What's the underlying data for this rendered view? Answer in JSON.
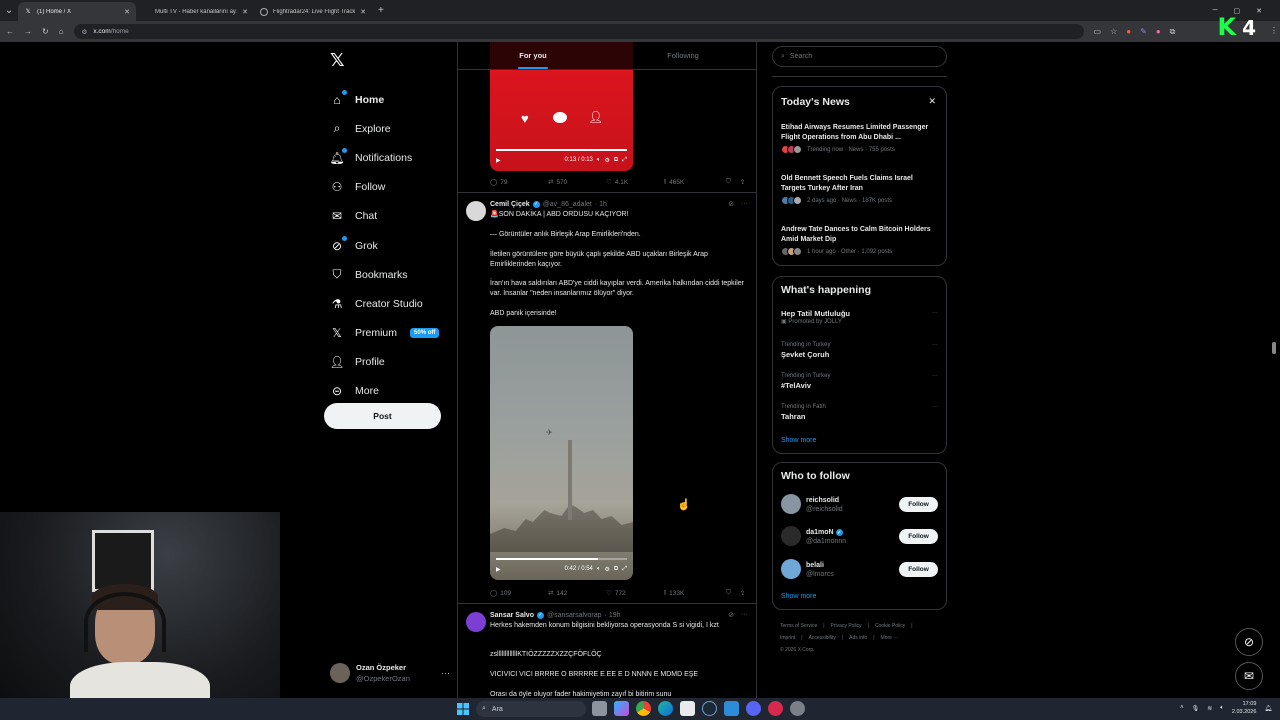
{
  "browser": {
    "tabs": [
      {
        "title": "(1) Home / X",
        "icon": "x-logo-icon",
        "active": true
      },
      {
        "title": "Multi TV - Haber kanallarını ay…",
        "icon": "tv-icon",
        "active": false
      },
      {
        "title": "Flightradar24: Live Flight Track…",
        "icon": "plane-icon",
        "active": false
      }
    ],
    "url_host": "x.com",
    "url_path": "/home",
    "kick_badge_letter": "K",
    "kick_badge_number": "4"
  },
  "nav": {
    "logo": "𝕏",
    "items": [
      {
        "label": "Home",
        "icon": "home-icon"
      },
      {
        "label": "Explore",
        "icon": "search-icon"
      },
      {
        "label": "Notifications",
        "icon": "bell-icon"
      },
      {
        "label": "Follow",
        "icon": "person-plus-icon"
      },
      {
        "label": "Chat",
        "icon": "mail-icon"
      },
      {
        "label": "Grok",
        "icon": "grok-icon"
      },
      {
        "label": "Bookmarks",
        "icon": "bookmark-icon"
      },
      {
        "label": "Creator Studio",
        "icon": "flask-icon"
      },
      {
        "label": "Premium",
        "icon": "x-logo-icon"
      },
      {
        "label": "Profile",
        "icon": "person-icon"
      },
      {
        "label": "More",
        "icon": "more-circle-icon"
      }
    ],
    "premium_badge": "50% off",
    "post_button": "Post",
    "account": {
      "name": "Ozan Özpeker",
      "handle": "@OzpekerOzan"
    }
  },
  "feed": {
    "tabs": [
      "For you",
      "Following"
    ],
    "first_post": {
      "video_time": "0:13 / 0:13",
      "replies": "79",
      "reposts": "570",
      "likes": "4.1K",
      "views": "465K"
    },
    "second_post": {
      "name": "Cemil Çiçek",
      "handle": "@av_86_adalet",
      "time": "· 1h",
      "lines": [
        "🚨SON DAKİKA | ABD ORDUSU KAÇIYOR!",
        "— Görüntüler anlık Birleşik Arap Emirlikleri'nden.",
        "İletilen görüntülere göre büyük çaplı şekilde ABD uçakları Birleşik Arap Emirliklerinden kaçıyor.",
        "İran'ın hava saldırıları ABD'ye ciddi kayıplar verdi. Amerika halkından ciddi tepkiler var. İnsanlar \"neden insanlarımız ölüyor\" diyor.",
        "ABD panik içerisinde!"
      ],
      "video_time": "0:42 / 0:54",
      "replies": "109",
      "reposts": "142",
      "likes": "772",
      "views": "133K"
    },
    "third_post": {
      "name": "Sansar Salvo",
      "handle": "@sansarsalvorap",
      "time": "· 19h",
      "lines": [
        "Herkes hakemden konum bilgisini bekliyorsa operasyonda S si vigidi, I kzt",
        "zslllllllllllllKTIÖZZZZZXZZÇFÖFLÖÇ",
        "VICIVICI VICI BRRRE O BRRRRE E EE E D NNNN E MDMD EŞE",
        "Orası da öyle oluyor fader hakimiyetim zayıf bi bitirim sunu"
      ]
    }
  },
  "right": {
    "search_placeholder": "Search",
    "news_title": "Today's News",
    "news": [
      {
        "title": "Etihad Airways Resumes Limited Passenger Flight Operations from Abu Dhabi ...",
        "meta": "Trending now · News · 755 posts"
      },
      {
        "title": "Old Bennett Speech Fuels Claims Israel Targets Turkey After Iran",
        "meta": "2 days ago · News · 187K posts"
      },
      {
        "title": "Andrew Tate Dances to Calm Bitcoin Holders Amid Market Dip",
        "meta": "1 hour ago · Other · 1,092 posts"
      }
    ],
    "happening_title": "What's happening",
    "trends": [
      {
        "context": "",
        "name": "Hep Tatil Mutluluğu",
        "sub": "Promoted by JOLLY"
      },
      {
        "context": "Trending in Turkey",
        "name": "Şevket Çoruh",
        "sub": ""
      },
      {
        "context": "Trending in Turkey",
        "name": "#TelAviv",
        "sub": ""
      },
      {
        "context": "Trending in Fatih",
        "name": "Tahran",
        "sub": ""
      }
    ],
    "show_more": "Show more",
    "who_title": "Who to follow",
    "who": [
      {
        "name": "reichsolid",
        "handle": "@reichsolid",
        "verified": false
      },
      {
        "name": "da1moN",
        "handle": "@da1monnn",
        "verified": true
      },
      {
        "name": "belali",
        "handle": "@lmorcs",
        "verified": false
      }
    ],
    "follow_label": "Follow",
    "footer": [
      "Terms of Service",
      "|",
      "Privacy Policy",
      "|",
      "Cookie Policy",
      "|",
      "Imprint",
      "|",
      "Accessibility",
      "|",
      "Ads info",
      "|",
      "More ···",
      "© 2026 X Corp."
    ]
  },
  "taskbar": {
    "search_label": "Ara",
    "time": "17:09",
    "date": "2.03.2026"
  },
  "colors": {
    "accent": "#1d9bf0",
    "bg": "#000000",
    "border": "#2f3336"
  }
}
